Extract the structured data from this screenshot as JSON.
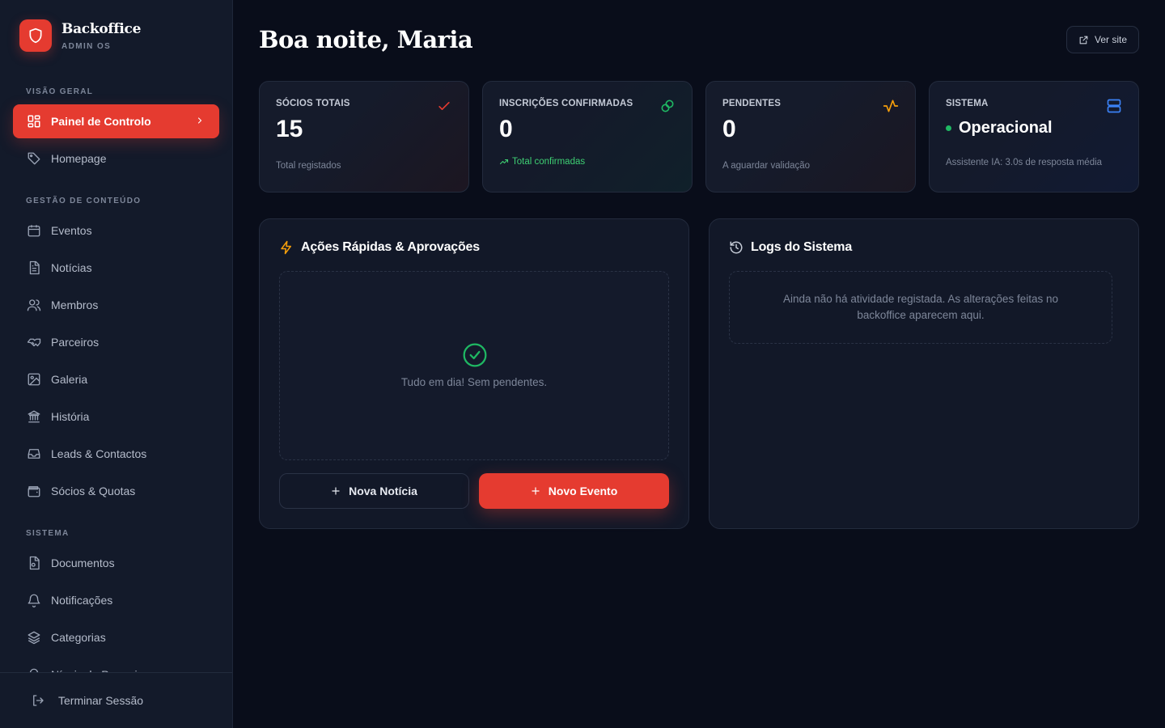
{
  "brand": {
    "title": "Backoffice",
    "subtitle": "ADMIN OS"
  },
  "sidebar": {
    "sections": [
      {
        "label": "VISÃO GERAL"
      },
      {
        "label": "GESTÃO DE CONTEÚDO"
      },
      {
        "label": "SISTEMA"
      }
    ],
    "items": [
      {
        "label": "Painel de Controlo",
        "icon": "dashboard-icon",
        "active": true
      },
      {
        "label": "Homepage",
        "icon": "tag-icon"
      },
      {
        "label": "Eventos",
        "icon": "calendar-icon"
      },
      {
        "label": "Notícias",
        "icon": "file-text-icon"
      },
      {
        "label": "Membros",
        "icon": "users-icon"
      },
      {
        "label": "Parceiros",
        "icon": "handshake-icon"
      },
      {
        "label": "Galeria",
        "icon": "image-icon"
      },
      {
        "label": "História",
        "icon": "landmark-icon"
      },
      {
        "label": "Leads & Contactos",
        "icon": "inbox-icon"
      },
      {
        "label": "Sócios & Quotas",
        "icon": "wallet-icon"
      },
      {
        "label": "Documentos",
        "icon": "file-cog-icon"
      },
      {
        "label": "Notificações",
        "icon": "bell-icon"
      },
      {
        "label": "Categorias",
        "icon": "layers-icon"
      },
      {
        "label": "Níveis de Parceria",
        "icon": "award-icon"
      }
    ],
    "logout_label": "Terminar Sessão"
  },
  "header": {
    "greeting": "Boa noite, Maria",
    "view_site_label": "Ver site"
  },
  "stats": [
    {
      "label": "SÓCIOS TOTAIS",
      "value": "15",
      "sub": "Total registados",
      "icon": "check-icon",
      "icon_color": "#e53b30"
    },
    {
      "label": "INSCRIÇÕES CONFIRMADAS",
      "value": "0",
      "sub": "Total confirmadas",
      "icon": "link-icon",
      "icon_color": "#1fb863"
    },
    {
      "label": "PENDENTES",
      "value": "0",
      "sub": "A aguardar validação",
      "icon": "activity-icon",
      "icon_color": "#f59e0b"
    },
    {
      "label": "SISTEMA",
      "value": "Operacional",
      "sub": "Assistente IA: 3.0s de resposta média",
      "icon": "server-icon",
      "icon_color": "#3b82f6"
    }
  ],
  "quick_actions": {
    "title": "Ações Rápidas & Aprovações",
    "empty_text": "Tudo em dia! Sem pendentes.",
    "new_news_label": "Nova Notícia",
    "new_event_label": "Novo Evento"
  },
  "logs": {
    "title": "Logs do Sistema",
    "empty_text": "Ainda não há atividade registada. As alterações feitas no backoffice aparecem aqui."
  },
  "colors": {
    "accent": "#e53b30",
    "success": "#1fb863",
    "warning": "#f59e0b",
    "info": "#3b82f6",
    "background": "#090d1a",
    "sidebar": "#131a2a"
  }
}
